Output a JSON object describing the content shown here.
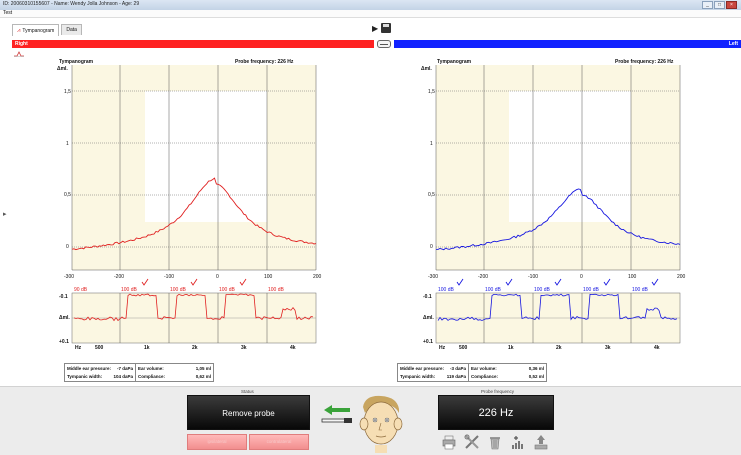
{
  "window": {
    "title": "ID: 20060310155607 - Name: Wendy Jolla Johnson - Age: 29",
    "menu": "Test"
  },
  "tabs": [
    {
      "label": "Tympanogram",
      "active": true
    },
    {
      "label": "Data",
      "active": false
    }
  ],
  "ears": {
    "right_label": "Right",
    "left_label": "Left",
    "right_color": "#ff2020",
    "left_color": "#1010ff"
  },
  "panels": [
    {
      "id": "right",
      "title": "Tympanogram",
      "probe_frequency": "Probe frequency: 226 Hz",
      "color": "#e02020",
      "y_unit": "Δml.",
      "y_ticks": [
        "1,5",
        "1",
        "0,5",
        "0"
      ],
      "x_ticks": [
        "-300",
        "-200",
        "-100",
        "0",
        "100",
        "200"
      ],
      "peak_x": -7,
      "peak_y": 0.62,
      "reflex_levels": [
        "90 dB",
        "100 dB",
        "100 dB",
        "100 dB",
        "100 dB"
      ],
      "reflex_checks": [
        false,
        true,
        true,
        true,
        false
      ],
      "reflex_y_ticks": [
        "-0.1",
        "Δml.",
        "+0.1"
      ],
      "reflex_x_labels": [
        "Hz",
        "500",
        "1k",
        "2k",
        "3k",
        "4k"
      ],
      "summary": {
        "mep_label": "Middle ear pressure:",
        "mep_value": "-7 daPa",
        "tw_label": "Tympanic width:",
        "tw_value": "104 daPa",
        "ev_label": "Ear volume:",
        "ev_value": "1,05 ml",
        "comp_label": "Compliance:",
        "comp_value": "0,62 ml"
      }
    },
    {
      "id": "left",
      "title": "Tympanogram",
      "probe_frequency": "Probe frequency: 226 Hz",
      "color": "#1515e0",
      "y_unit": "Δml.",
      "y_ticks": [
        "1,5",
        "1",
        "0,5",
        "0"
      ],
      "x_ticks": [
        "-300",
        "-200",
        "-100",
        "0",
        "100",
        "200"
      ],
      "peak_x": -3,
      "peak_y": 0.52,
      "reflex_levels": [
        "100 dB",
        "100 dB",
        "100 dB",
        "100 dB",
        "100 dB"
      ],
      "reflex_checks": [
        true,
        true,
        true,
        true,
        true
      ],
      "reflex_y_ticks": [
        "-0.1",
        "Δml.",
        "+0.1"
      ],
      "reflex_x_labels": [
        "Hz",
        "500",
        "1k",
        "2k",
        "3k",
        "4k"
      ],
      "summary": {
        "mep_label": "Middle ear pressure:",
        "mep_value": "-3 daPa",
        "tw_label": "Tympanic width:",
        "tw_value": "119 daPa",
        "ev_label": "Ear volume:",
        "ev_value": "0,36 ml",
        "comp_label": "Compliance:",
        "comp_value": "0,52 ml"
      }
    }
  ],
  "status": {
    "label": "Status",
    "button": "Remove probe",
    "secondary_buttons": [
      "ipsilateral",
      "contralateral"
    ]
  },
  "probe_panel": {
    "label": "Probe frequency",
    "value": "226 Hz"
  },
  "toolbar_icons": [
    "printer-icon",
    "settings-tools-icon",
    "trash-icon",
    "reflex-chart-icon",
    "upload-icon"
  ]
}
